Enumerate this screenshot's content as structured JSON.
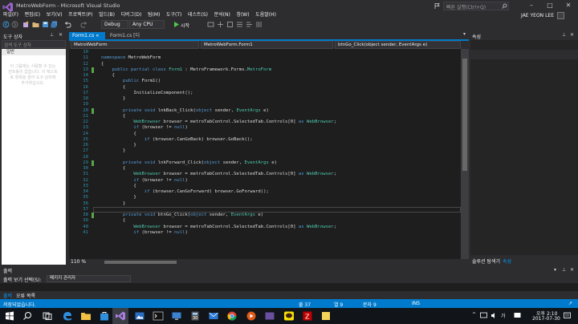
{
  "window": {
    "title": "MetroWebForm - Microsoft Visual Studio",
    "quick_launch_placeholder": "빠른 실행(Ctrl+Q)",
    "user_name": "JAE YEON LEE"
  },
  "menu": [
    "파일(F)",
    "편집(E)",
    "보기(V)",
    "프로젝트(P)",
    "빌드(B)",
    "디버그(D)",
    "팀(M)",
    "도구(T)",
    "테스트(S)",
    "분석(N)",
    "창(W)",
    "도움말(H)"
  ],
  "toolbar": {
    "config": "Debug",
    "platform": "Any CPU",
    "start_label": "시작"
  },
  "toolbox": {
    "title": "도구 상자",
    "search_placeholder": "검색 도구 상자",
    "group": "일반",
    "empty_message": "이 그룹에는 사용할 수 있는 컨트롤이 없습니다. 이 텍스트로 항목을 끌어 도구 상자에 추가하십시오."
  },
  "editor": {
    "tabs": [
      "Form1.cs",
      "Form1.cs [디자인]"
    ],
    "nav": [
      "MetroWebForm",
      "MetroWebForm.Form1",
      "btnGo_Click(object sender, EventArgs e)"
    ],
    "zoom": "110 %",
    "lines": [
      {
        "n": "10",
        "tokens": []
      },
      {
        "n": "11",
        "tokens": [
          [
            "kw",
            "namespace"
          ],
          [
            "",
            " MetroWebForm"
          ]
        ]
      },
      {
        "n": "12",
        "tokens": [
          [
            "",
            "{"
          ]
        ]
      },
      {
        "n": "13",
        "tokens": [
          [
            "",
            "    "
          ],
          [
            "kw",
            "public partial class"
          ],
          [
            "",
            " "
          ],
          [
            "ty",
            "Form1"
          ],
          [
            "",
            " : MetroFramework.Forms."
          ],
          [
            "ty",
            "MetroForm"
          ]
        ]
      },
      {
        "n": "14",
        "tokens": [
          [
            "",
            "    {"
          ]
        ]
      },
      {
        "n": "15",
        "tokens": [
          [
            "",
            "        "
          ],
          [
            "kw",
            "public"
          ],
          [
            "",
            " Form1()"
          ]
        ]
      },
      {
        "n": "16",
        "tokens": [
          [
            "",
            "        {"
          ]
        ]
      },
      {
        "n": "17",
        "tokens": [
          [
            "",
            "            InitializeComponent();"
          ]
        ]
      },
      {
        "n": "18",
        "tokens": [
          [
            "",
            "        }"
          ]
        ]
      },
      {
        "n": "19",
        "tokens": []
      },
      {
        "n": "20",
        "tokens": [
          [
            "",
            "        "
          ],
          [
            "kw",
            "private void"
          ],
          [
            "",
            " lnkBack_Click("
          ],
          [
            "kw",
            "object"
          ],
          [
            "",
            " sender, "
          ],
          [
            "ty",
            "EventArgs"
          ],
          [
            "",
            " e)"
          ]
        ]
      },
      {
        "n": "21",
        "tokens": [
          [
            "",
            "        {"
          ]
        ]
      },
      {
        "n": "22",
        "tokens": [
          [
            "",
            "            "
          ],
          [
            "ty",
            "WebBrowser"
          ],
          [
            "",
            " browser = metroTabControl.SelectedTab.Controls[0] "
          ],
          [
            "kw",
            "as"
          ],
          [
            "",
            " "
          ],
          [
            "ty",
            "WebBrowser"
          ],
          [
            "",
            ";"
          ]
        ]
      },
      {
        "n": "23",
        "tokens": [
          [
            "",
            "            "
          ],
          [
            "kw",
            "if"
          ],
          [
            "",
            " (browser != "
          ],
          [
            "kw",
            "null"
          ],
          [
            "",
            ")"
          ]
        ]
      },
      {
        "n": "24",
        "tokens": [
          [
            "",
            "            {"
          ]
        ]
      },
      {
        "n": "25",
        "tokens": [
          [
            "",
            "                "
          ],
          [
            "kw",
            "if"
          ],
          [
            "",
            " (browser.CanGoBack) browser.GoBack();"
          ]
        ]
      },
      {
        "n": "26",
        "tokens": [
          [
            "",
            "            }"
          ]
        ]
      },
      {
        "n": "27",
        "tokens": [
          [
            "",
            "        }"
          ]
        ]
      },
      {
        "n": "28",
        "tokens": []
      },
      {
        "n": "29",
        "tokens": [
          [
            "",
            "        "
          ],
          [
            "kw",
            "private void"
          ],
          [
            "",
            " lnkForward_Click("
          ],
          [
            "kw",
            "object"
          ],
          [
            "",
            " sender, "
          ],
          [
            "ty",
            "EventArgs"
          ],
          [
            "",
            " e)"
          ]
        ]
      },
      {
        "n": "30",
        "tokens": [
          [
            "",
            "        {"
          ]
        ]
      },
      {
        "n": "31",
        "tokens": [
          [
            "",
            "            "
          ],
          [
            "ty",
            "WebBrowser"
          ],
          [
            "",
            " browser = metroTabControl.SelectedTab.Controls[0] "
          ],
          [
            "kw",
            "as"
          ],
          [
            "",
            " "
          ],
          [
            "ty",
            "WebBrowser"
          ],
          [
            "",
            ";"
          ]
        ]
      },
      {
        "n": "32",
        "tokens": [
          [
            "",
            "            "
          ],
          [
            "kw",
            "if"
          ],
          [
            "",
            " (browser != "
          ],
          [
            "kw",
            "null"
          ],
          [
            "",
            ")"
          ]
        ]
      },
      {
        "n": "33",
        "tokens": [
          [
            "",
            "            {"
          ]
        ]
      },
      {
        "n": "34",
        "tokens": [
          [
            "",
            "                "
          ],
          [
            "kw",
            "if"
          ],
          [
            "",
            " (browser.CanGoForward) browser.GoForward();"
          ]
        ]
      },
      {
        "n": "35",
        "tokens": [
          [
            "",
            "            }"
          ]
        ]
      },
      {
        "n": "36",
        "tokens": [
          [
            "",
            "        }"
          ]
        ]
      },
      {
        "n": "37",
        "tokens": []
      },
      {
        "n": "38",
        "tokens": [
          [
            "",
            "        "
          ],
          [
            "kw",
            "private void"
          ],
          [
            "",
            " btnGo_Click("
          ],
          [
            "kw",
            "object"
          ],
          [
            "",
            " sender, "
          ],
          [
            "ty",
            "EventArgs"
          ],
          [
            "",
            " e)"
          ]
        ]
      },
      {
        "n": "39",
        "tokens": [
          [
            "",
            "        {"
          ]
        ]
      },
      {
        "n": "40",
        "tokens": [
          [
            "",
            "            "
          ],
          [
            "ty",
            "WebBrowser"
          ],
          [
            "",
            " browser = metroTabControl.SelectedTab.Controls[0] "
          ],
          [
            "kw",
            "as"
          ],
          [
            "",
            " "
          ],
          [
            "ty",
            "WebBrowser"
          ],
          [
            "",
            ";"
          ]
        ]
      },
      {
        "n": "41",
        "tokens": [
          [
            "",
            "            "
          ],
          [
            "kw",
            "if"
          ],
          [
            "",
            " (browser != "
          ],
          [
            "kw",
            "null"
          ],
          [
            "",
            ")"
          ]
        ]
      }
    ],
    "changed_lines": [
      "13",
      "20",
      "29",
      "38"
    ],
    "current_line": "37"
  },
  "properties": {
    "title": "속성",
    "tabs": [
      "솔루션 탐색기",
      "속성"
    ]
  },
  "output": {
    "title": "출력",
    "source_label": "출력 보기 선택(S):",
    "source_value": "패키지 관리자",
    "tabs": [
      "출력",
      "오류 목록"
    ]
  },
  "status": {
    "message": "저장되었습니다.",
    "line": "줄 37",
    "col": "열 9",
    "char": "문자 9",
    "mode": "INS"
  },
  "taskbar": {
    "time": "오후 2:10",
    "date": "2017-07-30"
  },
  "colors": {
    "accent": "#007acc",
    "editor_bg": "#1e1e1e",
    "keyword": "#569cd6",
    "type": "#4ec9b0",
    "line_number": "#2b91af",
    "vs_purple": "#68217a"
  }
}
